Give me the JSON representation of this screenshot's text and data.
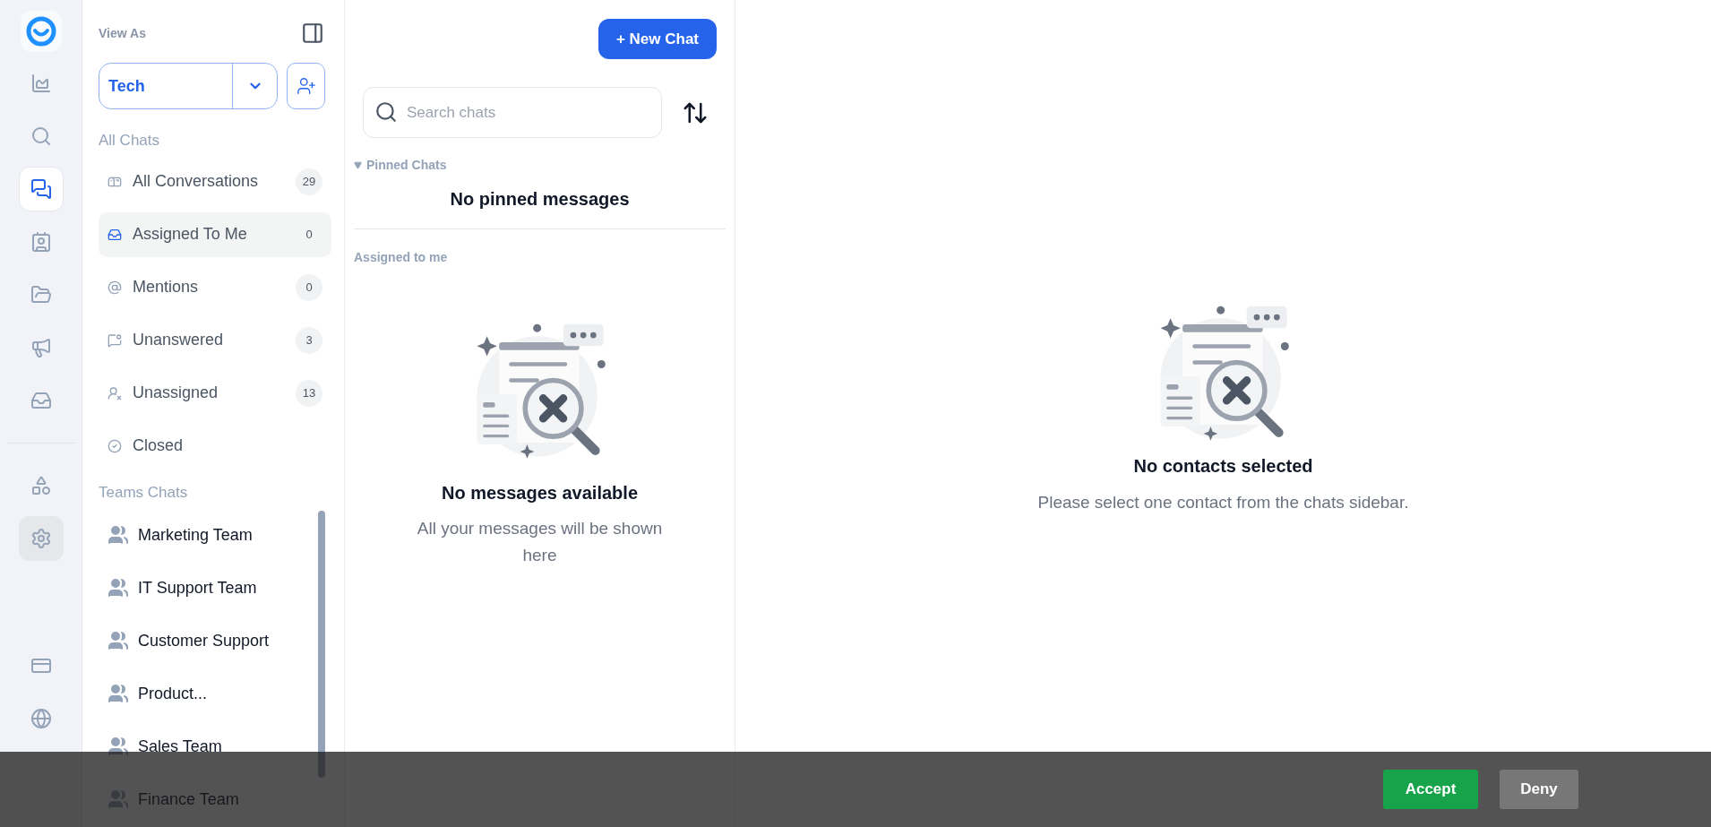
{
  "rail": {
    "items": [
      {
        "selected": false
      },
      {
        "selected": false
      },
      {
        "selected": true
      },
      {
        "selected": false
      },
      {
        "selected": false
      },
      {
        "selected": false
      },
      {
        "selected": false
      }
    ],
    "lower_items": [
      {
        "selected": false,
        "hovered": false
      },
      {
        "selected": false,
        "hovered": true
      }
    ]
  },
  "sidebar": {
    "view_as_label": "View As",
    "view_as_value": "Tech",
    "all_chats_heading": "All Chats",
    "chat_filters": [
      {
        "label": "All Conversations",
        "count": "29",
        "selected": false
      },
      {
        "label": "Assigned To Me",
        "count": "0",
        "selected": true
      },
      {
        "label": "Mentions",
        "count": "0",
        "selected": false
      },
      {
        "label": "Unanswered",
        "count": "3",
        "selected": false
      },
      {
        "label": "Unassigned",
        "count": "13",
        "selected": false
      },
      {
        "label": "Closed",
        "selected": false
      }
    ],
    "teams_heading": "Teams Chats",
    "teams": [
      {
        "label": "Marketing Team"
      },
      {
        "label": "IT Support Team"
      },
      {
        "label": "Customer Support"
      },
      {
        "label": "Product..."
      },
      {
        "label": "Sales Team"
      },
      {
        "label": "Finance Team"
      }
    ]
  },
  "chat_list": {
    "new_chat_button": "+ New Chat",
    "search": {
      "placeholder": "Search chats"
    },
    "pinned": {
      "heading": "Pinned Chats",
      "expanded": true,
      "empty_text": "No pinned messages"
    },
    "assigned_heading": "Assigned to me",
    "empty_state": {
      "title": "No messages available",
      "text": "All your messages will be shown here"
    }
  },
  "main": {
    "empty_state": {
      "title": "No contacts selected",
      "text": "Please select one contact from the chats sidebar."
    }
  },
  "cookie_bar": {
    "buttons": [
      {
        "label": "Accept",
        "kind": "primary"
      },
      {
        "label": "Deny",
        "kind": "secondary"
      }
    ]
  }
}
